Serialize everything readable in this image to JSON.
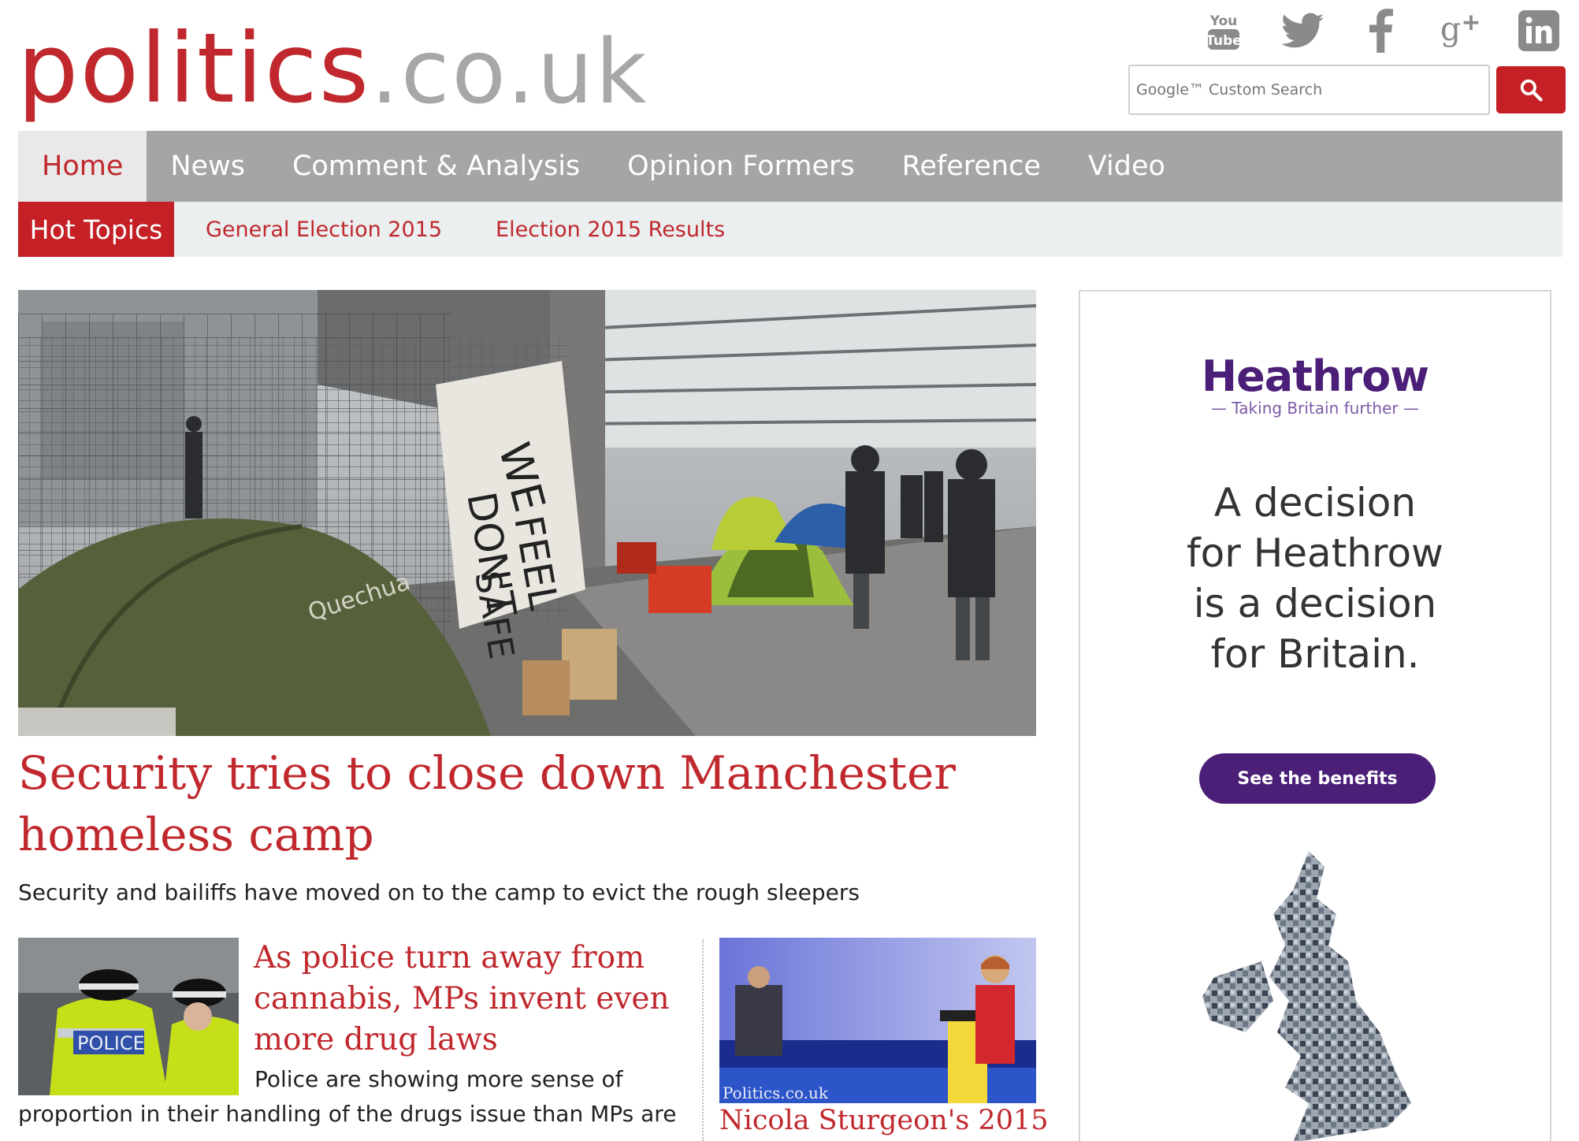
{
  "site": {
    "brand": "politics",
    "tld": ".co.uk",
    "colors": {
      "brand_red": "#c0282d",
      "grey": "#a7a7a7",
      "nav_grey": "#a5a5a5",
      "heathrow_purple": "#4b1f78"
    }
  },
  "social": [
    {
      "name": "youtube-icon",
      "label": "You Tube"
    },
    {
      "name": "twitter-icon"
    },
    {
      "name": "facebook-icon",
      "label": "f"
    },
    {
      "name": "google-plus-icon",
      "label": "g+"
    },
    {
      "name": "linkedin-icon",
      "label": "in"
    }
  ],
  "search": {
    "placeholder": "Google™ Custom Search",
    "button_icon": "search-icon"
  },
  "nav": {
    "items": [
      "Home",
      "News",
      "Comment & Analysis",
      "Opinion Formers",
      "Reference",
      "Video"
    ],
    "active": "Home"
  },
  "subnav": {
    "hot": "Hot Topics",
    "links": [
      "General Election 2015",
      "Election 2015 Results"
    ]
  },
  "lead": {
    "headline": "Security tries to close down Manchester homeless camp",
    "standfirst": "Security and bailiffs have moved on to the camp to evict the rough sleepers",
    "image_text": {
      "banner": "WE DON'T FEEL SAFE",
      "tent": "Quechua"
    }
  },
  "story2": {
    "headline": "As police turn away from cannabis, MPs invent even more drug laws",
    "body": "Police are showing more sense of proportion in their handling of the drugs issue than MPs are",
    "image_text": "POLICE"
  },
  "story3": {
    "headline": "Nicola Sturgeon's 2015",
    "image_text": "Politics.co.uk"
  },
  "ad": {
    "logo": "Heathrow",
    "tagline": "— Taking Britain further —",
    "copy_lines": [
      "A decision",
      "for Heathrow",
      "is a decision",
      "for Britain."
    ],
    "cta": "See the benefits"
  }
}
